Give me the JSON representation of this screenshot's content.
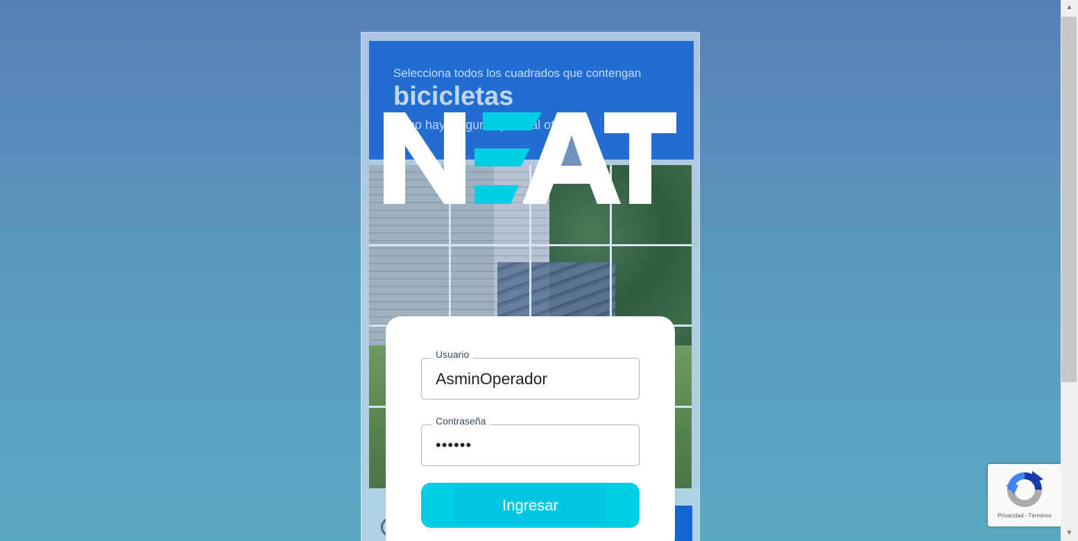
{
  "captcha": {
    "instruction": "Selecciona todos los cuadrados que contengan",
    "object": "bicicletas",
    "subtext": "Si no hay ninguno, pasa al otro"
  },
  "logo": {
    "text": "NEAT"
  },
  "login": {
    "username_label": "Usuario",
    "username_value": "AsminOperador",
    "password_label": "Contraseña",
    "password_value": "••••••",
    "submit_label": "Ingresar"
  },
  "recaptcha": {
    "links": "Privacidad - Términos"
  },
  "colors": {
    "background_top": "#5780b7",
    "background_bottom": "#5aa9c2",
    "accent_cyan": "#00cfe6",
    "captcha_blue": "#1565d0"
  }
}
